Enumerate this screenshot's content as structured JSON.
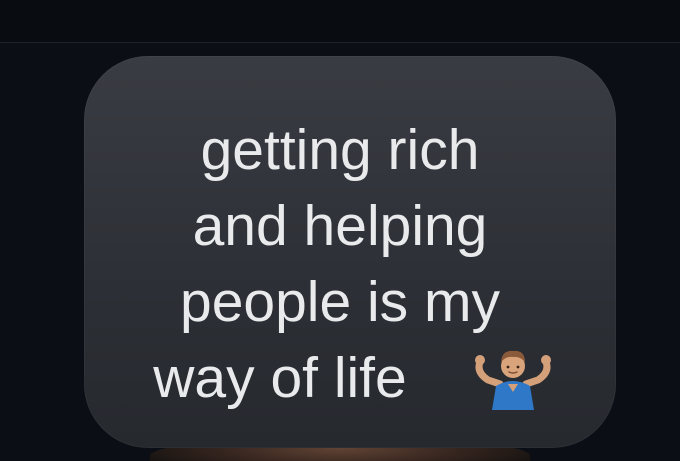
{
  "colors": {
    "background": "#0b0f15",
    "bubble": "#2f3238",
    "text": "#e9eaec"
  },
  "message": {
    "lines": [
      "getting rich",
      "and helping",
      "people is my",
      "way of life"
    ],
    "emoji": "person-shrugging-icon"
  }
}
